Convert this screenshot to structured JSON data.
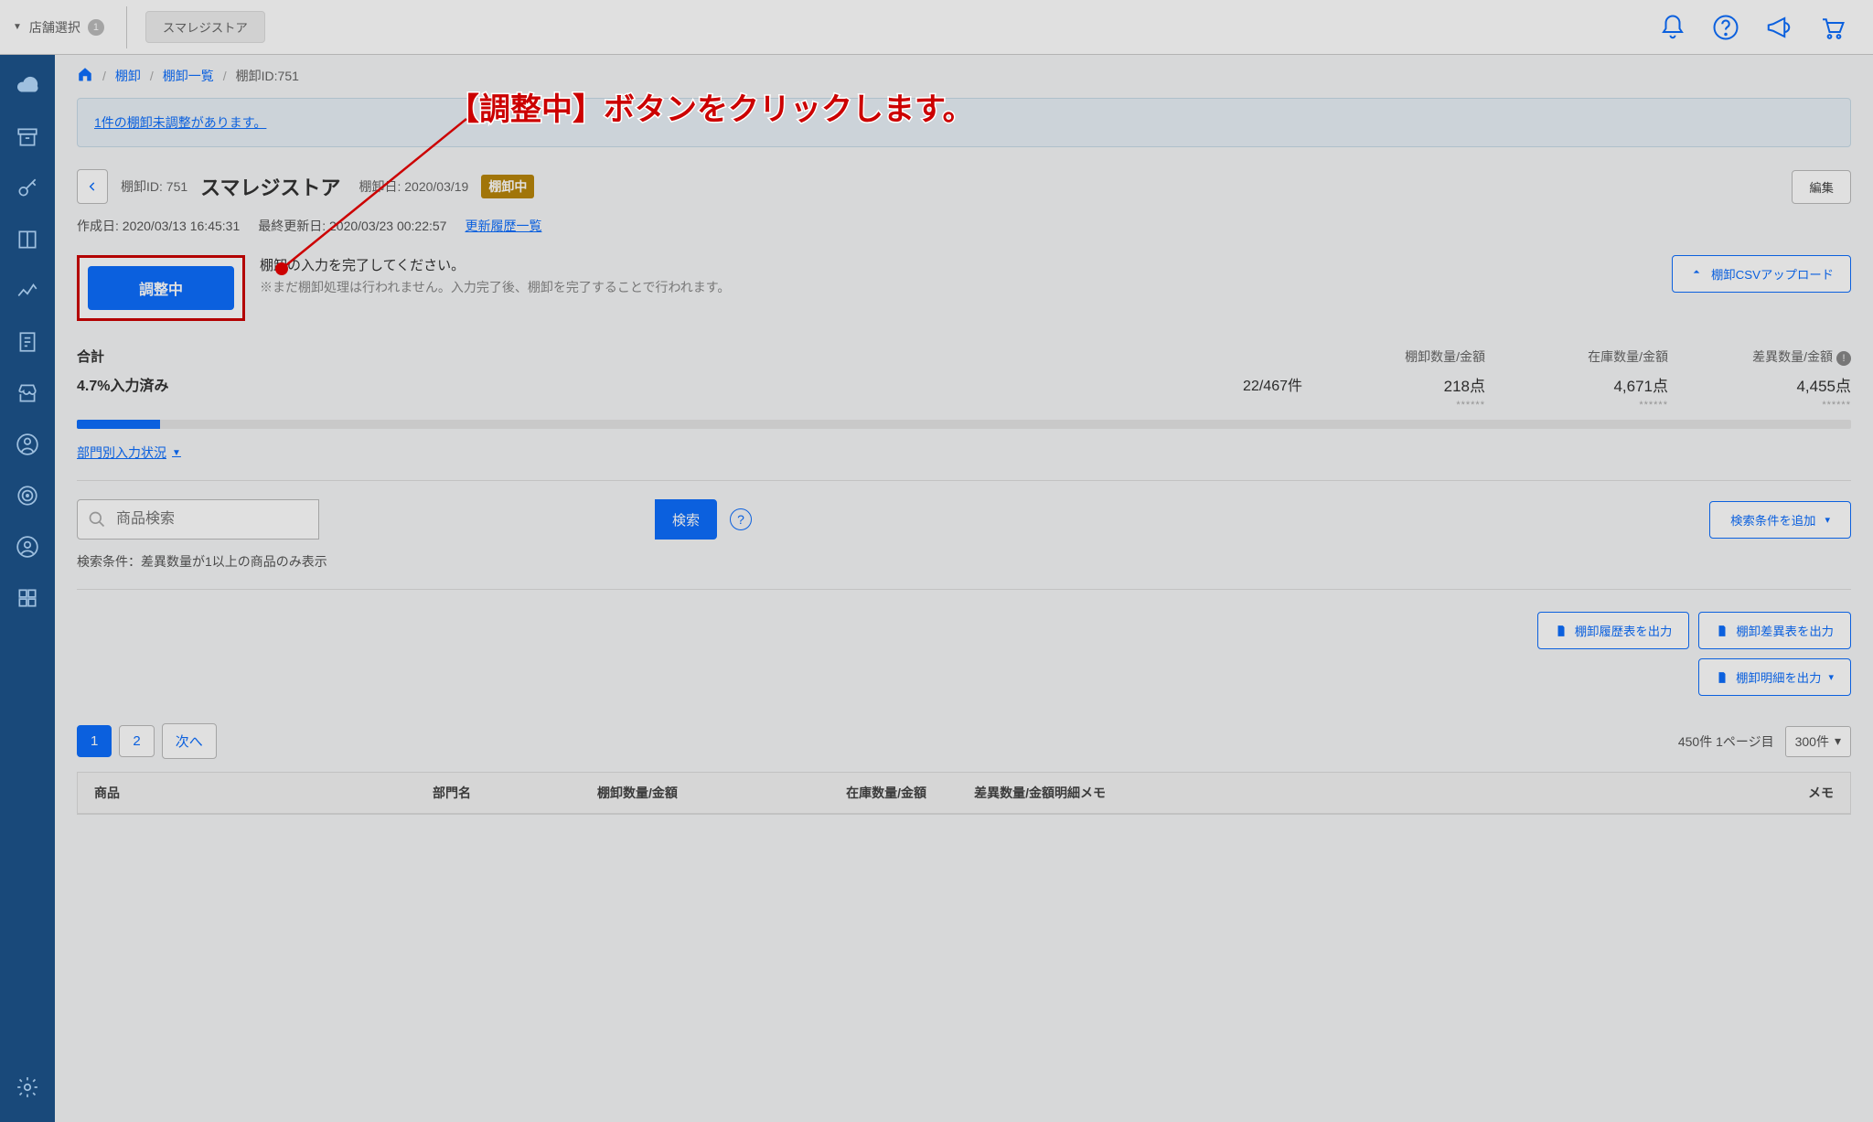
{
  "header": {
    "store_select_label": "店舗選択",
    "store_badge": "1",
    "store_button": "スマレジストア"
  },
  "breadcrumb": {
    "items": [
      "棚卸",
      "棚卸一覧",
      "棚卸ID:751"
    ]
  },
  "notice": {
    "link_prefix": "1件",
    "link_text": "の棚卸未調整があります。"
  },
  "title": {
    "id_label": "棚卸ID: 751",
    "store": "スマレジストア",
    "date_label": "棚卸日: 2020/03/19",
    "status": "棚卸中",
    "edit_btn": "編集"
  },
  "meta": {
    "created": "作成日: 2020/03/13 16:45:31",
    "updated": "最終更新日: 2020/03/23 00:22:57",
    "history_link": "更新履歴一覧"
  },
  "action": {
    "adjust_btn": "調整中",
    "line1": "棚卸の入力を完了してください。",
    "line2": "※まだ棚卸処理は行われません。入力完了後、棚卸を完了することで行われます。",
    "csv_btn": "棚卸CSVアップロード"
  },
  "summary": {
    "label": "合計",
    "col1": "棚卸数量/金額",
    "col2": "在庫数量/金額",
    "col3": "差異数量/金額",
    "pct_label": "4.7%入力済み",
    "ratio": "22/467件",
    "val1": "218点",
    "val2": "4,671点",
    "val3": "4,455点",
    "stars": "******",
    "dept_link": "部門別入力状況"
  },
  "search": {
    "placeholder": "商品検索",
    "search_btn": "検索",
    "add_cond_btn": "検索条件を追加",
    "cond_label": "検索条件：差異数量が1以上の商品のみ表示"
  },
  "exports": {
    "history": "棚卸履歴表を出力",
    "diff": "棚卸差異表を出力",
    "detail": "棚卸明細を出力"
  },
  "pager": {
    "p1": "1",
    "p2": "2",
    "next": "次へ",
    "info": "450件 1ページ目",
    "per_page": "300件"
  },
  "table": {
    "h_product": "商品",
    "h_dept": "部門名",
    "h_inv": "棚卸数量/金額",
    "h_stock": "在庫数量/金額",
    "h_diff": "差異数量/金額",
    "h_memo": "明細メモ",
    "h_note": "メモ"
  },
  "callout": "【調整中】ボタンをクリックします。"
}
